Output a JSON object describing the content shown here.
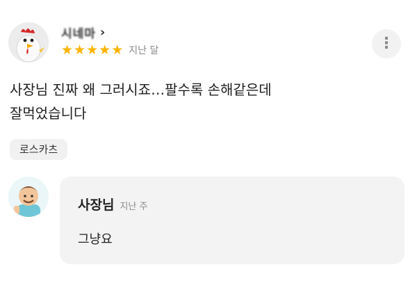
{
  "review": {
    "user_name": "시네마",
    "chevron": "›",
    "rating": 5,
    "stars": [
      "★",
      "★",
      "★",
      "★",
      "★"
    ],
    "time": "지난 달",
    "more_icon": "⋮",
    "text_line1": "사장님 진짜 왜 그러시죠…팔수록 손해같은데",
    "text_line2": "잘먹었습니다",
    "menu_tag": "로스카츠"
  },
  "reply": {
    "owner_name": "사장님",
    "time": "지난 주",
    "text": "그냥요"
  },
  "colors": {
    "star": "#ffb400",
    "bubble": "#f3f3f3",
    "muted_text": "#8a8a8a"
  }
}
